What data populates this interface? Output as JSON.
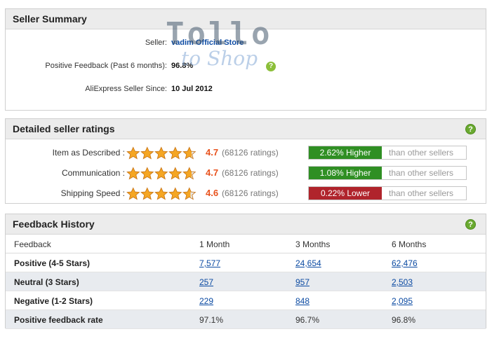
{
  "summary": {
    "title": "Seller Summary",
    "seller_label": "Seller:",
    "seller_name": "vadim Official Store",
    "positive_label": "Positive Feedback (Past 6 months):",
    "positive_value": "96.8%",
    "since_label": "AliExpress Seller Since:",
    "since_value": "10 Jul 2012",
    "watermark_main": "Tollo",
    "watermark_sub": "to Shop"
  },
  "ratings": {
    "title": "Detailed seller ratings",
    "rows": [
      {
        "label": "Item as Described :",
        "score": "4.7",
        "score_value": 4.7,
        "count": "(68126 ratings)",
        "badge": "2.62% Higher",
        "badge_type": "higher",
        "compare": "than other sellers"
      },
      {
        "label": "Communication :",
        "score": "4.7",
        "score_value": 4.7,
        "count": "(68126 ratings)",
        "badge": "1.08% Higher",
        "badge_type": "higher",
        "compare": "than other sellers"
      },
      {
        "label": "Shipping Speed :",
        "score": "4.6",
        "score_value": 4.6,
        "count": "(68126 ratings)",
        "badge": "0.22% Lower",
        "badge_type": "lower",
        "compare": "than other sellers"
      }
    ]
  },
  "history": {
    "title": "Feedback History",
    "columns": [
      "Feedback",
      "1 Month",
      "3 Months",
      "6 Months"
    ],
    "rows": [
      {
        "label": "Positive (4-5 Stars)",
        "values": [
          "7,577",
          "24,654",
          "62,476"
        ]
      },
      {
        "label": "Neutral (3 Stars)",
        "values": [
          "257",
          "957",
          "2,503"
        ]
      },
      {
        "label": "Negative (1-2 Stars)",
        "values": [
          "229",
          "848",
          "2,095"
        ]
      },
      {
        "label": "Positive feedback rate",
        "values": [
          "97.1%",
          "96.7%",
          "96.8%"
        ]
      }
    ]
  },
  "icons": {
    "help": "help-icon",
    "star": "star-icon"
  },
  "colors": {
    "higher": "#2f8f23",
    "lower": "#b0242c",
    "score": "#e8531e",
    "link": "#0b4aa2",
    "star": "#f5a623"
  },
  "help_glyph": "?"
}
